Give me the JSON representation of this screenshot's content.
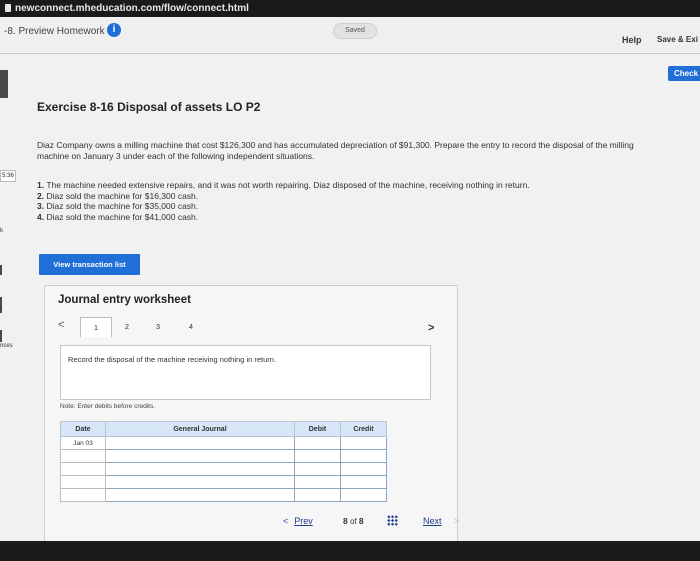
{
  "browser": {
    "url": "newconnect.mheducation.com/flow/connect.html"
  },
  "header": {
    "title": "-8. Preview Homework",
    "info_icon": "i",
    "saved": "Saved",
    "help": "Help",
    "save_exit": "Save & Exi"
  },
  "check_button": "Check",
  "side": {
    "timer": "5:36",
    "label_k": "k",
    "label_t": "t",
    "label_nces": "nces"
  },
  "exercise": {
    "title": "Exercise 8-16 Disposal of assets LO P2",
    "description": "Diaz Company owns a milling machine that cost $126,300 and has accumulated depreciation of $91,300. Prepare the entry to record the disposal of the milling machine on January 3 under each of the following independent situations.",
    "situations": [
      {
        "num": "1.",
        "text": "The machine needed extensive repairs, and it was not worth repairing. Diaz disposed of the machine, receiving nothing in return."
      },
      {
        "num": "2.",
        "text": "Diaz sold the machine for $16,300 cash."
      },
      {
        "num": "3.",
        "text": "Diaz sold the machine for $35,000 cash."
      },
      {
        "num": "4.",
        "text": "Diaz sold the machine for $41,000 cash."
      }
    ]
  },
  "view_transaction_button": "View transaction list",
  "worksheet": {
    "title": "Journal entry worksheet",
    "prev_arrow": "<",
    "next_arrow": ">",
    "tabs": [
      "1",
      "2",
      "3",
      "4"
    ],
    "instruction": "Record the disposal of the machine receiving nothing in return.",
    "note": "Note: Enter debits before credits.",
    "table": {
      "headers": [
        "Date",
        "General Journal",
        "Debit",
        "Credit"
      ],
      "rows": [
        {
          "date": "Jan 03"
        },
        {
          "date": ""
        },
        {
          "date": ""
        },
        {
          "date": ""
        },
        {
          "date": ""
        }
      ]
    }
  },
  "pagination": {
    "prev_chevron": "<",
    "prev": "Prev",
    "current": "8",
    "of": "of",
    "total": "8",
    "next": "Next",
    "next_chevron": ">"
  },
  "icons": {
    "info": "info-icon",
    "lock": "lock-icon",
    "grid": "grid-icon"
  }
}
